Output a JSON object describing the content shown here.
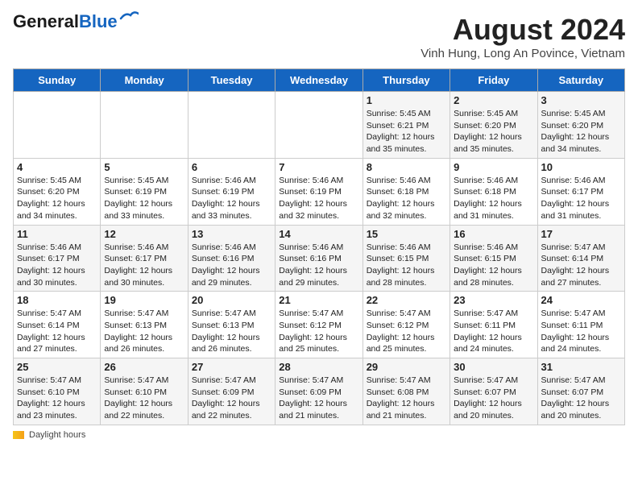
{
  "header": {
    "logo_line1": "General",
    "logo_line2": "Blue",
    "title": "August 2024",
    "subtitle": "Vinh Hung, Long An Povince, Vietnam"
  },
  "weekdays": [
    "Sunday",
    "Monday",
    "Tuesday",
    "Wednesday",
    "Thursday",
    "Friday",
    "Saturday"
  ],
  "weeks": [
    [
      {
        "day": "",
        "info": ""
      },
      {
        "day": "",
        "info": ""
      },
      {
        "day": "",
        "info": ""
      },
      {
        "day": "",
        "info": ""
      },
      {
        "day": "1",
        "info": "Sunrise: 5:45 AM\nSunset: 6:21 PM\nDaylight: 12 hours and 35 minutes."
      },
      {
        "day": "2",
        "info": "Sunrise: 5:45 AM\nSunset: 6:20 PM\nDaylight: 12 hours and 35 minutes."
      },
      {
        "day": "3",
        "info": "Sunrise: 5:45 AM\nSunset: 6:20 PM\nDaylight: 12 hours and 34 minutes."
      }
    ],
    [
      {
        "day": "4",
        "info": "Sunrise: 5:45 AM\nSunset: 6:20 PM\nDaylight: 12 hours and 34 minutes."
      },
      {
        "day": "5",
        "info": "Sunrise: 5:45 AM\nSunset: 6:19 PM\nDaylight: 12 hours and 33 minutes."
      },
      {
        "day": "6",
        "info": "Sunrise: 5:46 AM\nSunset: 6:19 PM\nDaylight: 12 hours and 33 minutes."
      },
      {
        "day": "7",
        "info": "Sunrise: 5:46 AM\nSunset: 6:19 PM\nDaylight: 12 hours and 32 minutes."
      },
      {
        "day": "8",
        "info": "Sunrise: 5:46 AM\nSunset: 6:18 PM\nDaylight: 12 hours and 32 minutes."
      },
      {
        "day": "9",
        "info": "Sunrise: 5:46 AM\nSunset: 6:18 PM\nDaylight: 12 hours and 31 minutes."
      },
      {
        "day": "10",
        "info": "Sunrise: 5:46 AM\nSunset: 6:17 PM\nDaylight: 12 hours and 31 minutes."
      }
    ],
    [
      {
        "day": "11",
        "info": "Sunrise: 5:46 AM\nSunset: 6:17 PM\nDaylight: 12 hours and 30 minutes."
      },
      {
        "day": "12",
        "info": "Sunrise: 5:46 AM\nSunset: 6:17 PM\nDaylight: 12 hours and 30 minutes."
      },
      {
        "day": "13",
        "info": "Sunrise: 5:46 AM\nSunset: 6:16 PM\nDaylight: 12 hours and 29 minutes."
      },
      {
        "day": "14",
        "info": "Sunrise: 5:46 AM\nSunset: 6:16 PM\nDaylight: 12 hours and 29 minutes."
      },
      {
        "day": "15",
        "info": "Sunrise: 5:46 AM\nSunset: 6:15 PM\nDaylight: 12 hours and 28 minutes."
      },
      {
        "day": "16",
        "info": "Sunrise: 5:46 AM\nSunset: 6:15 PM\nDaylight: 12 hours and 28 minutes."
      },
      {
        "day": "17",
        "info": "Sunrise: 5:47 AM\nSunset: 6:14 PM\nDaylight: 12 hours and 27 minutes."
      }
    ],
    [
      {
        "day": "18",
        "info": "Sunrise: 5:47 AM\nSunset: 6:14 PM\nDaylight: 12 hours and 27 minutes."
      },
      {
        "day": "19",
        "info": "Sunrise: 5:47 AM\nSunset: 6:13 PM\nDaylight: 12 hours and 26 minutes."
      },
      {
        "day": "20",
        "info": "Sunrise: 5:47 AM\nSunset: 6:13 PM\nDaylight: 12 hours and 26 minutes."
      },
      {
        "day": "21",
        "info": "Sunrise: 5:47 AM\nSunset: 6:12 PM\nDaylight: 12 hours and 25 minutes."
      },
      {
        "day": "22",
        "info": "Sunrise: 5:47 AM\nSunset: 6:12 PM\nDaylight: 12 hours and 25 minutes."
      },
      {
        "day": "23",
        "info": "Sunrise: 5:47 AM\nSunset: 6:11 PM\nDaylight: 12 hours and 24 minutes."
      },
      {
        "day": "24",
        "info": "Sunrise: 5:47 AM\nSunset: 6:11 PM\nDaylight: 12 hours and 24 minutes."
      }
    ],
    [
      {
        "day": "25",
        "info": "Sunrise: 5:47 AM\nSunset: 6:10 PM\nDaylight: 12 hours and 23 minutes."
      },
      {
        "day": "26",
        "info": "Sunrise: 5:47 AM\nSunset: 6:10 PM\nDaylight: 12 hours and 22 minutes."
      },
      {
        "day": "27",
        "info": "Sunrise: 5:47 AM\nSunset: 6:09 PM\nDaylight: 12 hours and 22 minutes."
      },
      {
        "day": "28",
        "info": "Sunrise: 5:47 AM\nSunset: 6:09 PM\nDaylight: 12 hours and 21 minutes."
      },
      {
        "day": "29",
        "info": "Sunrise: 5:47 AM\nSunset: 6:08 PM\nDaylight: 12 hours and 21 minutes."
      },
      {
        "day": "30",
        "info": "Sunrise: 5:47 AM\nSunset: 6:07 PM\nDaylight: 12 hours and 20 minutes."
      },
      {
        "day": "31",
        "info": "Sunrise: 5:47 AM\nSunset: 6:07 PM\nDaylight: 12 hours and 20 minutes."
      }
    ]
  ],
  "footer": {
    "daylight_label": "Daylight hours"
  }
}
